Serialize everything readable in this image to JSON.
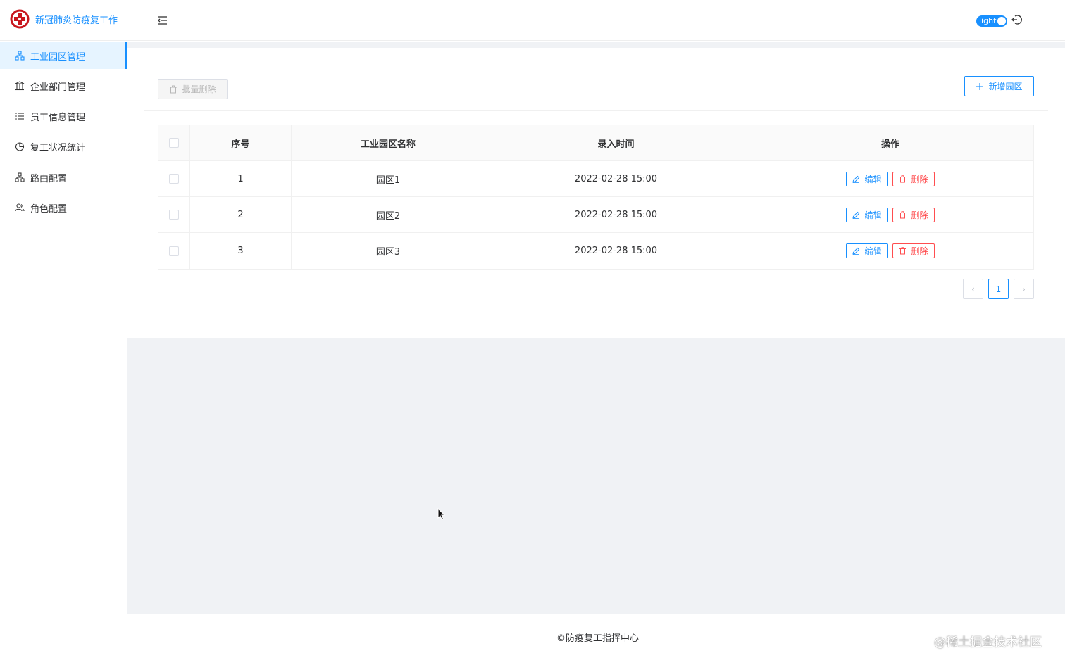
{
  "header": {
    "title": "新冠肺炎防疫复工作",
    "logo_icon": "red-cross-logo-icon",
    "collapse_icon": "menu-fold-icon",
    "theme_label": "light",
    "logout_icon": "logout-icon"
  },
  "sidebar": {
    "items": [
      {
        "label": "工业园区管理",
        "icon": "cluster-icon",
        "active": true
      },
      {
        "label": "企业部门管理",
        "icon": "bank-icon",
        "active": false
      },
      {
        "label": "员工信息管理",
        "icon": "list-icon",
        "active": false
      },
      {
        "label": "复工状况统计",
        "icon": "pie-chart-icon",
        "active": false
      },
      {
        "label": "路由配置",
        "icon": "cluster-icon",
        "active": false
      },
      {
        "label": "角色配置",
        "icon": "team-icon",
        "active": false
      }
    ]
  },
  "toolbar": {
    "batch_delete_label": "批量删除",
    "add_label": "新增园区"
  },
  "table": {
    "columns": [
      "序号",
      "工业园区名称",
      "录入时间",
      "操作"
    ],
    "rows": [
      {
        "index": "1",
        "name": "园区1",
        "time": "2022-02-28 15:00"
      },
      {
        "index": "2",
        "name": "园区2",
        "time": "2022-02-28 15:00"
      },
      {
        "index": "3",
        "name": "园区3",
        "time": "2022-02-28 15:00"
      }
    ],
    "edit_label": "编辑",
    "delete_label": "删除"
  },
  "pagination": {
    "prev": "‹",
    "current_page": "1",
    "next": "›"
  },
  "footer": {
    "text": "©防疫复工指挥中心"
  },
  "watermark": "@稀土掘金技术社区",
  "colors": {
    "primary": "#1890ff",
    "danger": "#ff4d4f",
    "logo": "#c8161d",
    "content_bg": "#f0f2f5"
  }
}
